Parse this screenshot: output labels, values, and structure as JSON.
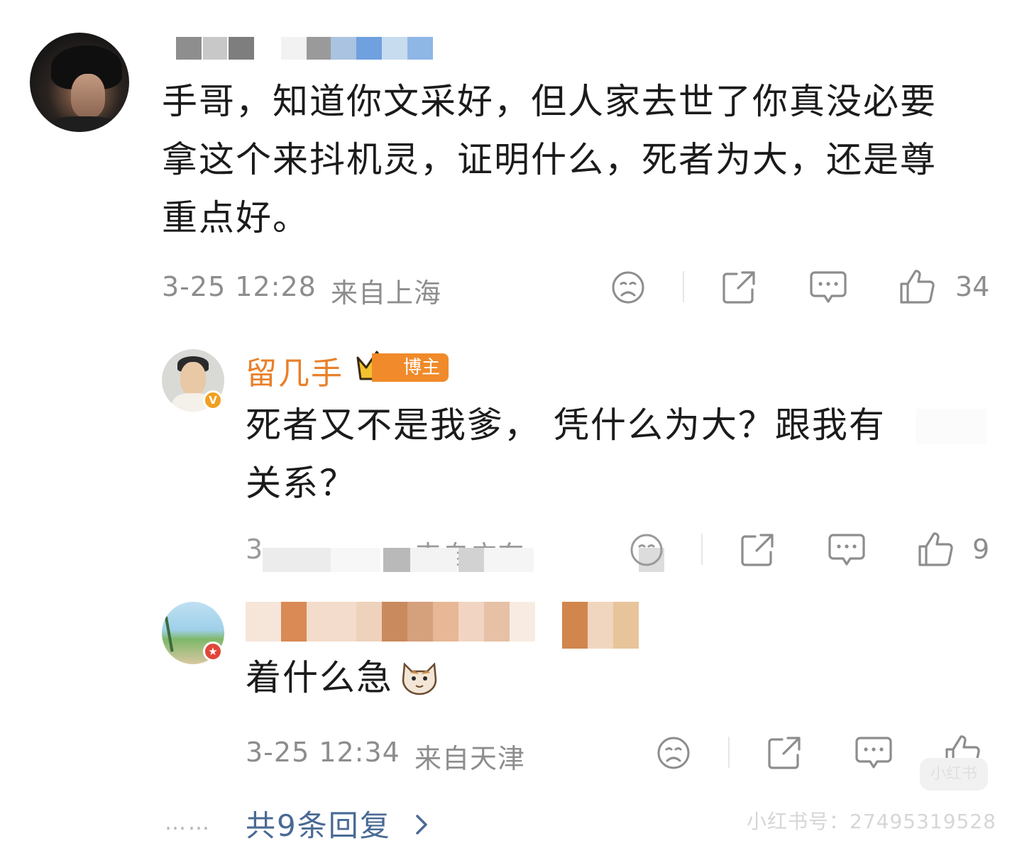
{
  "main_comment": {
    "text_lines": [
      "手哥，知道你文采好，但人家去世了你真没必要",
      "拿这个来抖机灵，证明什么，死者为大，还是尊",
      "重点好。"
    ],
    "time": "3-25 12:28",
    "location": "来自上海",
    "likes": "34"
  },
  "reply1": {
    "author": "留几手",
    "role": "博主",
    "text_lines": [
      "死者又不是我爹， 凭什么为大？跟我有",
      "关系？"
    ],
    "time_partial": "3-",
    "location_partial": "来自广东",
    "likes": "9"
  },
  "reply2": {
    "text": "着什么急",
    "time": "3-25 12:34",
    "location": "来自天津"
  },
  "footer": {
    "dots": "……",
    "more_replies": "共9条回复",
    "watermark": "小红书号：27495319528",
    "watermark_logo": "小红书"
  },
  "colors": {
    "author_orange": "#e8802a",
    "link_blue": "#4a6a94",
    "meta_gray": "#8d8d8d"
  }
}
